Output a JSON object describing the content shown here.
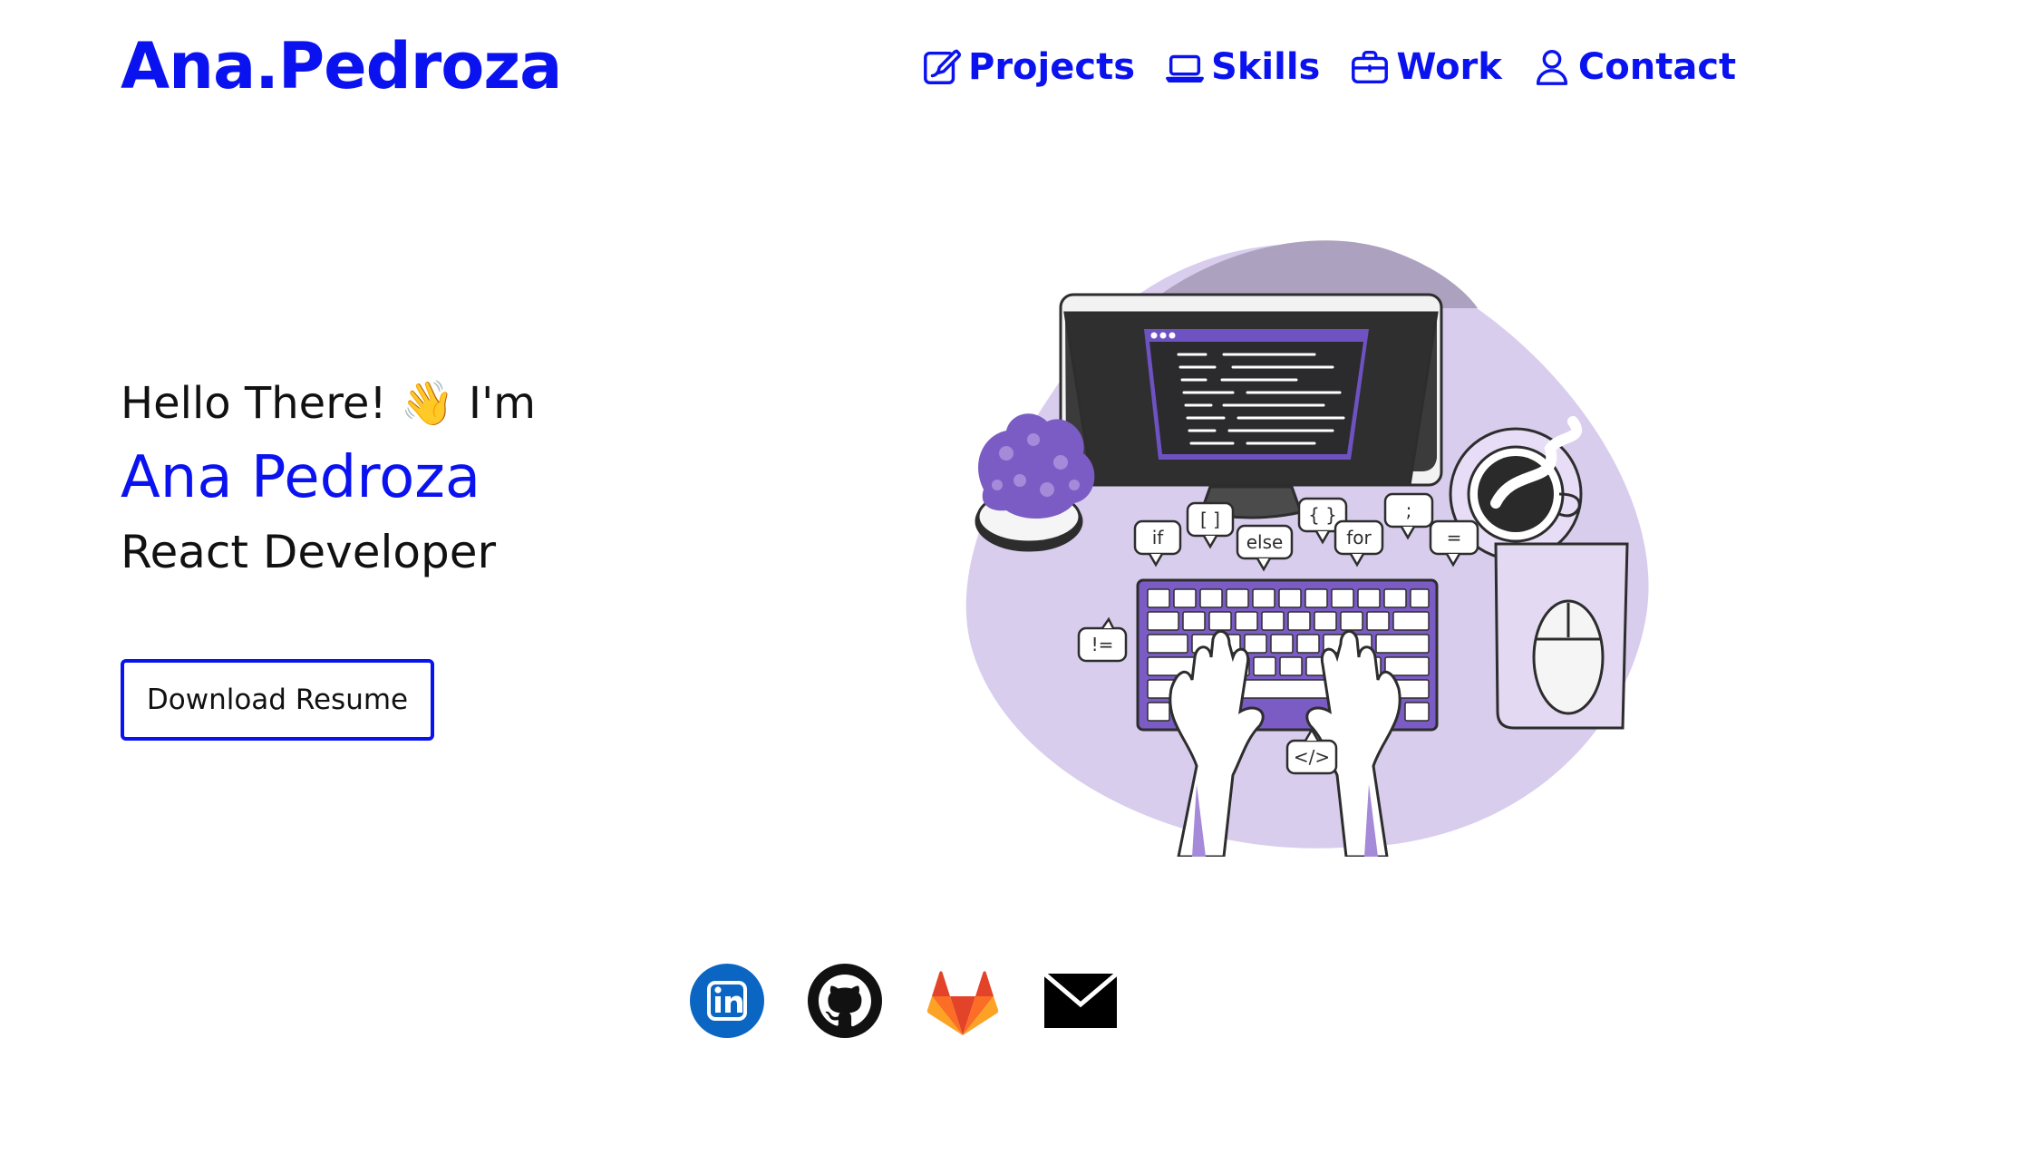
{
  "header": {
    "logo": "Ana.Pedroza",
    "nav": [
      {
        "label": "Projects",
        "icon": "edit-icon"
      },
      {
        "label": "Skills",
        "icon": "laptop-icon"
      },
      {
        "label": "Work",
        "icon": "briefcase-icon"
      },
      {
        "label": "Contact",
        "icon": "user-icon"
      }
    ]
  },
  "hero": {
    "greeting": "Hello There! 👋 I'm",
    "name": "Ana Pedroza",
    "role": "React Developer",
    "resume_button": "Download Resume",
    "illustration": {
      "bubbles": [
        "if",
        "[ ]",
        "else",
        "{ }",
        "for",
        ";",
        "=",
        "!=",
        "</>"
      ]
    }
  },
  "socials": [
    {
      "name": "linkedin-icon"
    },
    {
      "name": "github-icon"
    },
    {
      "name": "gitlab-icon"
    },
    {
      "name": "email-icon"
    }
  ],
  "colors": {
    "accent": "#0a12f0",
    "lavender": "#d8cdef",
    "purple": "#7b5cc4",
    "dark_purple": "#5b3fa8"
  }
}
